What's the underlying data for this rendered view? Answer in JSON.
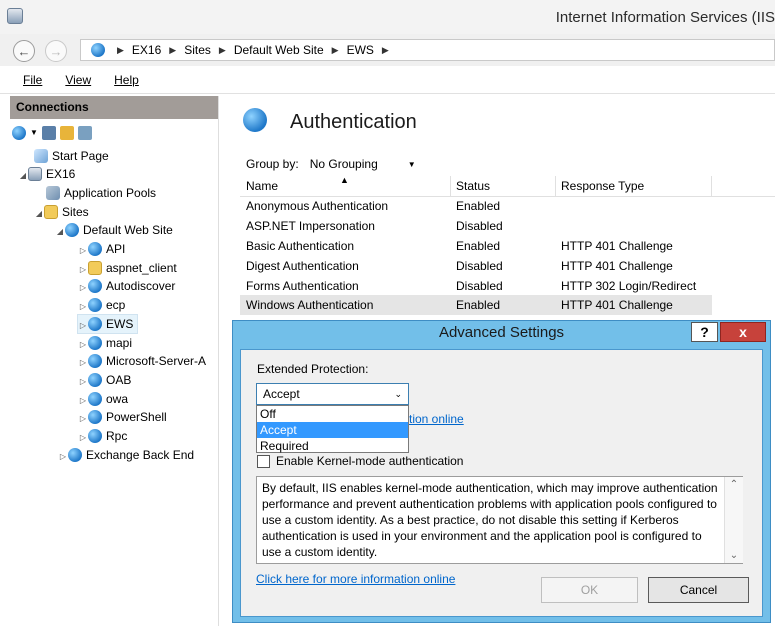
{
  "window": {
    "title": "Internet Information Services (IIS"
  },
  "address": {
    "crumbs": [
      "EX16",
      "Sites",
      "Default Web Site",
      "EWS"
    ]
  },
  "menu": {
    "file": "File",
    "view": "View",
    "help": "Help"
  },
  "connections": {
    "header": "Connections",
    "tree": {
      "start_page": "Start Page",
      "server": "EX16",
      "app_pools": "Application Pools",
      "sites": "Sites",
      "default_site": "Default Web Site",
      "children": [
        "API",
        "aspnet_client",
        "Autodiscover",
        "ecp",
        "EWS",
        "mapi",
        "Microsoft-Server-A",
        "OAB",
        "owa",
        "PowerShell",
        "Rpc"
      ],
      "exchange_back_end": "Exchange Back End"
    }
  },
  "main": {
    "title": "Authentication",
    "group_by_label": "Group by:",
    "group_by_value": "No Grouping",
    "columns": {
      "name": "Name",
      "status": "Status",
      "response": "Response Type"
    },
    "rows": [
      {
        "name": "Anonymous Authentication",
        "status": "Enabled",
        "response": ""
      },
      {
        "name": "ASP.NET Impersonation",
        "status": "Disabled",
        "response": ""
      },
      {
        "name": "Basic Authentication",
        "status": "Enabled",
        "response": "HTTP 401 Challenge"
      },
      {
        "name": "Digest Authentication",
        "status": "Disabled",
        "response": "HTTP 401 Challenge"
      },
      {
        "name": "Forms Authentication",
        "status": "Disabled",
        "response": "HTTP 302 Login/Redirect"
      },
      {
        "name": "Windows Authentication",
        "status": "Enabled",
        "response": "HTTP 401 Challenge"
      }
    ]
  },
  "dialog": {
    "title": "Advanced Settings",
    "help": "?",
    "close": "x",
    "ep_label": "Extended Protection:",
    "ep_value": "Accept",
    "ep_options": [
      "Off",
      "Accept",
      "Required"
    ],
    "hidden_link_fragment": "tion online",
    "kernel_label": "Enable Kernel-mode authentication",
    "description": "By default, IIS enables kernel-mode authentication, which may improve authentication performance and prevent authentication problems with application pools configured to use a custom identity. As a best practice, do not disable this setting if Kerberos authentication is used in your environment and the application pool is configured to use a custom identity.",
    "more_link": "Click here for more information online",
    "ok": "OK",
    "cancel": "Cancel"
  }
}
